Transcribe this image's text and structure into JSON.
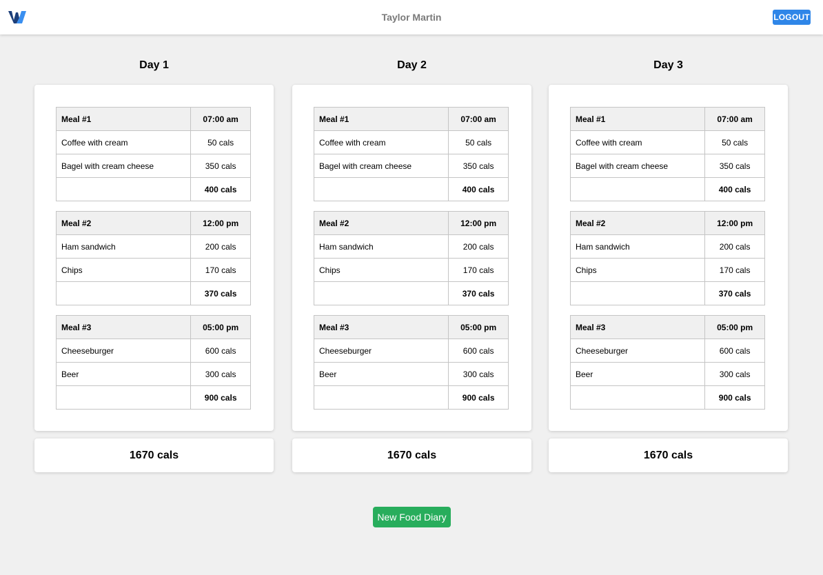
{
  "header": {
    "user_name": "Taylor Martin",
    "logout_label": "LOGOUT"
  },
  "colors": {
    "primary": "#2f86e8",
    "success": "#28ad5c",
    "background": "#f0f0f0"
  },
  "days": [
    {
      "title": "Day 1",
      "meals": [
        {
          "name": "Meal #1",
          "time": "07:00 am",
          "items": [
            {
              "food": "Coffee with cream",
              "cals": "50 cals"
            },
            {
              "food": "Bagel with cream cheese",
              "cals": "350 cals"
            }
          ],
          "total": "400 cals"
        },
        {
          "name": "Meal #2",
          "time": "12:00 pm",
          "items": [
            {
              "food": "Ham sandwich",
              "cals": "200 cals"
            },
            {
              "food": "Chips",
              "cals": "170 cals"
            }
          ],
          "total": "370 cals"
        },
        {
          "name": "Meal #3",
          "time": "05:00 pm",
          "items": [
            {
              "food": "Cheeseburger",
              "cals": "600 cals"
            },
            {
              "food": "Beer",
              "cals": "300 cals"
            }
          ],
          "total": "900 cals"
        }
      ],
      "day_total": "1670 cals"
    },
    {
      "title": "Day 2",
      "meals": [
        {
          "name": "Meal #1",
          "time": "07:00 am",
          "items": [
            {
              "food": "Coffee with cream",
              "cals": "50 cals"
            },
            {
              "food": "Bagel with cream cheese",
              "cals": "350 cals"
            }
          ],
          "total": "400 cals"
        },
        {
          "name": "Meal #2",
          "time": "12:00 pm",
          "items": [
            {
              "food": "Ham sandwich",
              "cals": "200 cals"
            },
            {
              "food": "Chips",
              "cals": "170 cals"
            }
          ],
          "total": "370 cals"
        },
        {
          "name": "Meal #3",
          "time": "05:00 pm",
          "items": [
            {
              "food": "Cheeseburger",
              "cals": "600 cals"
            },
            {
              "food": "Beer",
              "cals": "300 cals"
            }
          ],
          "total": "900 cals"
        }
      ],
      "day_total": "1670 cals"
    },
    {
      "title": "Day 3",
      "meals": [
        {
          "name": "Meal #1",
          "time": "07:00 am",
          "items": [
            {
              "food": "Coffee with cream",
              "cals": "50 cals"
            },
            {
              "food": "Bagel with cream cheese",
              "cals": "350 cals"
            }
          ],
          "total": "400 cals"
        },
        {
          "name": "Meal #2",
          "time": "12:00 pm",
          "items": [
            {
              "food": "Ham sandwich",
              "cals": "200 cals"
            },
            {
              "food": "Chips",
              "cals": "170 cals"
            }
          ],
          "total": "370 cals"
        },
        {
          "name": "Meal #3",
          "time": "05:00 pm",
          "items": [
            {
              "food": "Cheeseburger",
              "cals": "600 cals"
            },
            {
              "food": "Beer",
              "cals": "300 cals"
            }
          ],
          "total": "900 cals"
        }
      ],
      "day_total": "1670 cals"
    }
  ],
  "actions": {
    "new_diary_label": "New Food Diary"
  }
}
